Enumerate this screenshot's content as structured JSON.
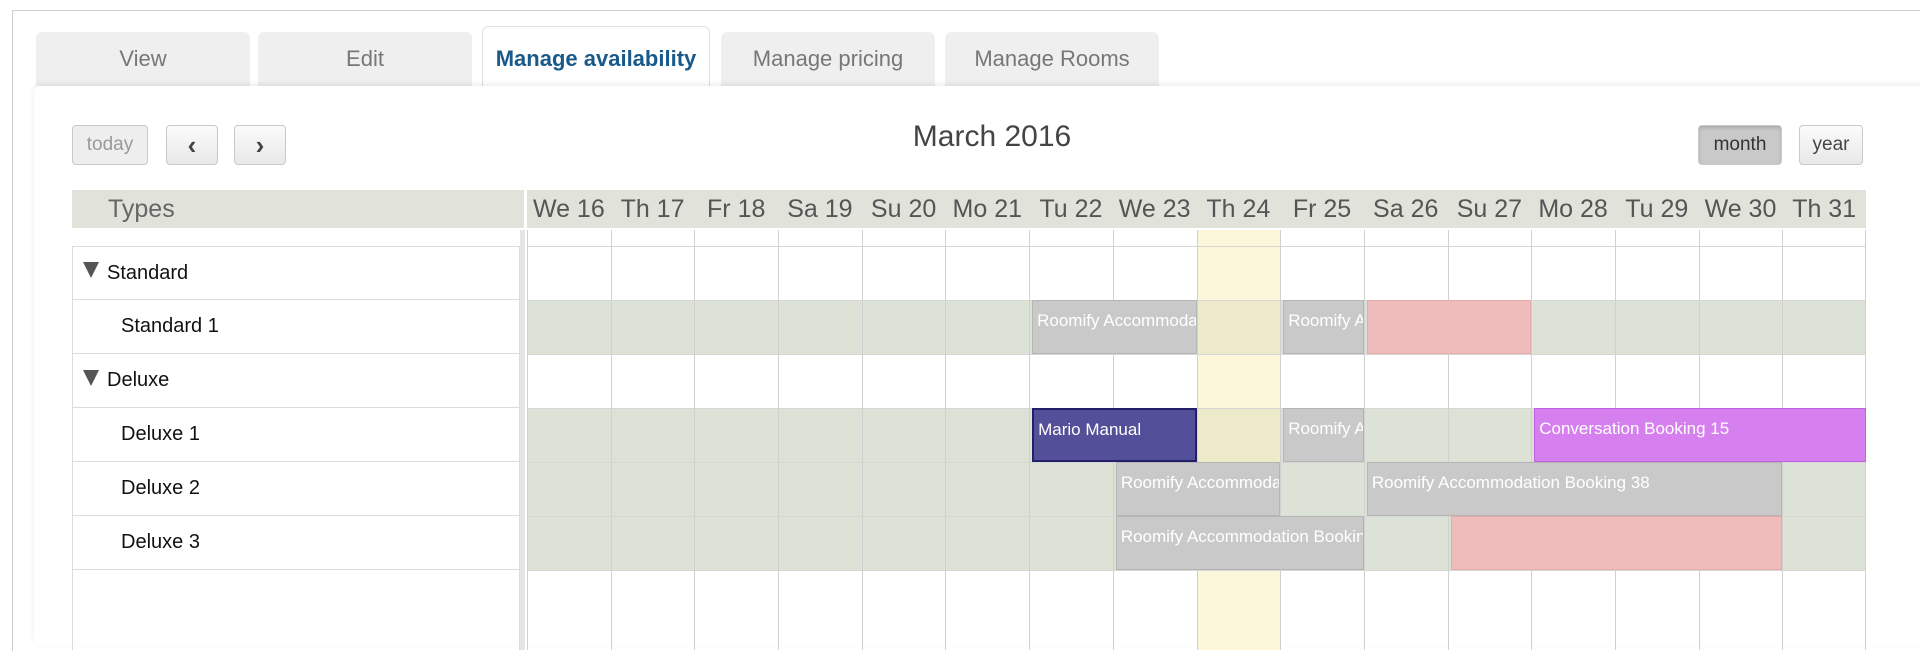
{
  "tabs": [
    {
      "label": "View",
      "active": false
    },
    {
      "label": "Edit",
      "active": false
    },
    {
      "label": "Manage availability",
      "active": true
    },
    {
      "label": "Manage pricing",
      "active": false
    },
    {
      "label": "Manage Rooms",
      "active": false
    }
  ],
  "toolbar": {
    "today_label": "today",
    "prev_label": "‹",
    "next_label": "›",
    "title": "March 2016",
    "month_label": "month",
    "year_label": "year"
  },
  "calendar": {
    "types_header": "Types",
    "days": [
      "We 16",
      "Th 17",
      "Fr 18",
      "Sa 19",
      "Su 20",
      "Mo 21",
      "Tu 22",
      "We 23",
      "Th 24",
      "Fr 25",
      "Sa 26",
      "Su 27",
      "Mo 28",
      "Tu 29",
      "We 30",
      "Th 31"
    ],
    "highlight_day": "Th 24",
    "rows": [
      {
        "label": "Standard",
        "kind": "group"
      },
      {
        "label": "Standard 1",
        "kind": "item"
      },
      {
        "label": "Deluxe",
        "kind": "group"
      },
      {
        "label": "Deluxe 1",
        "kind": "item"
      },
      {
        "label": "Deluxe 2",
        "kind": "item"
      },
      {
        "label": "Deluxe 3",
        "kind": "item"
      }
    ],
    "events": [
      {
        "row": 1,
        "start_day": "Tu 22",
        "end_day": "We 23",
        "label": "Roomify Accommodation Booking",
        "color": "#c9c9c9"
      },
      {
        "row": 1,
        "start_day": "Fr 25",
        "end_day": "Fr 25",
        "label": "Roomify Accommodation Booking",
        "color": "#c9c9c9"
      },
      {
        "row": 1,
        "start_day": "Sa 26",
        "end_day": "Su 27",
        "label": "",
        "color": "#efbcbc"
      },
      {
        "row": 3,
        "start_day": "Tu 22",
        "end_day": "We 23",
        "label": "Mario Manual",
        "color": "#534f99"
      },
      {
        "row": 3,
        "start_day": "Fr 25",
        "end_day": "Fr 25",
        "label": "Roomify Accommodation Booking",
        "color": "#c9c9c9"
      },
      {
        "row": 3,
        "start_day": "Mo 28",
        "end_day": "Th 31",
        "label": "Conversation Booking 15",
        "color": "#d680f0"
      },
      {
        "row": 4,
        "start_day": "We 23",
        "end_day": "Th 24",
        "label": "Roomify Accommodation Booking",
        "color": "#c9c9c9"
      },
      {
        "row": 4,
        "start_day": "Sa 26",
        "end_day": "We 30",
        "label": "Roomify Accommodation Booking 38",
        "color": "#c9c9c9"
      },
      {
        "row": 5,
        "start_day": "We 23",
        "end_day": "Fr 25",
        "label": "Roomify Accommodation Booking",
        "color": "#c9c9c9"
      },
      {
        "row": 5,
        "start_day": "Su 27",
        "end_day": "We 30",
        "label": "",
        "color": "#efbcbc"
      }
    ]
  }
}
